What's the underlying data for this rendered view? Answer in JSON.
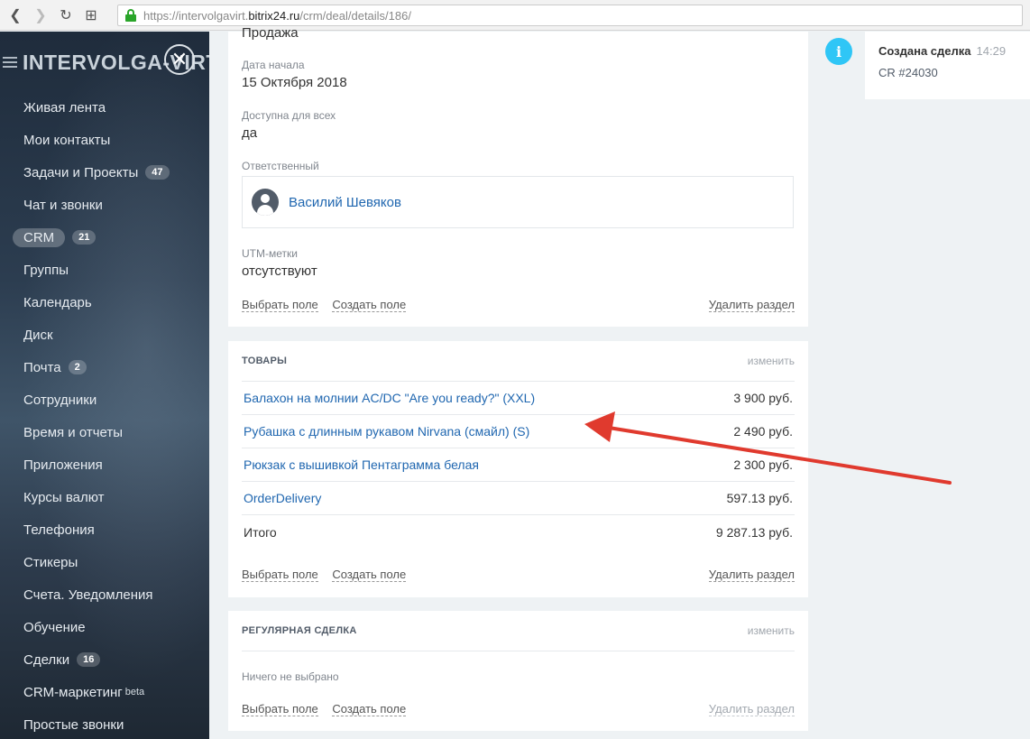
{
  "browser": {
    "url_prefix": "https://intervolgavirt.",
    "url_host": "bitrix24.ru",
    "url_path": "/crm/deal/details/186/",
    "icons": [
      "back-icon",
      "forward-icon",
      "reload-icon",
      "apps-icon",
      "lock-icon"
    ]
  },
  "sidebar": {
    "brand": "INTERVOLGA-VIRT",
    "items": [
      {
        "label": "Живая лента"
      },
      {
        "label": "Мои контакты"
      },
      {
        "label": "Задачи и Проекты",
        "badge": "47"
      },
      {
        "label": "Чат и звонки"
      },
      {
        "label": "CRM",
        "badge": "21"
      },
      {
        "label": "Группы"
      },
      {
        "label": "Календарь"
      },
      {
        "label": "Диск"
      },
      {
        "label": "Почта",
        "badge": "2"
      },
      {
        "label": "Сотрудники"
      },
      {
        "label": "Время и отчеты"
      },
      {
        "label": "Приложения"
      },
      {
        "label": "Курсы валют"
      },
      {
        "label": "Телефония"
      },
      {
        "label": "Стикеры"
      },
      {
        "label": "Счета. Уведомления"
      },
      {
        "label": "Обучение"
      },
      {
        "label": "Сделки",
        "badge": "16"
      },
      {
        "label": "CRM-маркетинг",
        "sup": "beta"
      },
      {
        "label": "Простые звонки"
      }
    ]
  },
  "deal_info": {
    "top_value": "Продажа",
    "start_date_label": "Дата начала",
    "start_date_value": "15 Октября 2018",
    "available_label": "Доступна для всех",
    "available_value": "да",
    "responsible_label": "Ответственный",
    "responsible_name": "Василий Шевяков",
    "utm_label": "UTM-метки",
    "utm_value": "отсутствуют",
    "select_field": "Выбрать поле",
    "create_field": "Создать поле",
    "delete_section": "Удалить раздел"
  },
  "products": {
    "title": "ТОВАРЫ",
    "edit": "изменить",
    "rows": [
      {
        "name": "Балахон на молнии AC/DC \"Are you ready?\" (XXL)",
        "price": "3 900 руб."
      },
      {
        "name": "Рубашка с длинным рукавом Nirvana (смайл) (S)",
        "price": "2 490 руб."
      },
      {
        "name": "Рюкзак с вышивкой Пентаграмма белая",
        "price": "2 300 руб."
      },
      {
        "name": "OrderDelivery",
        "price": "597.13 руб."
      }
    ],
    "total_label": "Итого",
    "total_value": "9 287.13 руб.",
    "select_field": "Выбрать поле",
    "create_field": "Создать поле",
    "delete_section": "Удалить раздел"
  },
  "recurring": {
    "title": "РЕГУЛЯРНАЯ СДЕЛКА",
    "edit": "изменить",
    "empty": "Ничего не выбрано",
    "select_field": "Выбрать поле",
    "create_field": "Создать поле",
    "delete_section": "Удалить раздел"
  },
  "timeline": {
    "title": "Создана сделка",
    "time": "14:29",
    "subtitle": "CR #24030"
  },
  "colors": {
    "link": "#2067b0",
    "accent": "#2fc6f6",
    "annotation_arrow": "#e03a2e"
  }
}
